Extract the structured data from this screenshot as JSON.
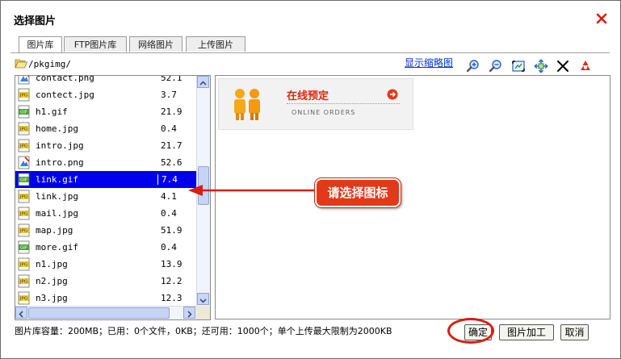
{
  "dialog": {
    "title": "选择图片"
  },
  "tabs": [
    {
      "label": "图片库",
      "active": true
    },
    {
      "label": "FTP图片库",
      "active": false
    },
    {
      "label": "网络图片",
      "active": false
    },
    {
      "label": "上传图片",
      "active": false
    }
  ],
  "toolbar": {
    "path": "/pkgimg/",
    "thumbnail_link": "显示缩略图",
    "icons": [
      "zoom-in-icon",
      "zoom-out-icon",
      "fit-icon",
      "original-size-icon",
      "delete-icon",
      "refresh-icon"
    ]
  },
  "files": [
    {
      "name": "contact.png",
      "size": "52.1",
      "type": "png"
    },
    {
      "name": "contect.jpg",
      "size": "3.7",
      "type": "jpg"
    },
    {
      "name": "h1.gif",
      "size": "21.9",
      "type": "gif"
    },
    {
      "name": "home.jpg",
      "size": "0.4",
      "type": "jpg"
    },
    {
      "name": "intro.jpg",
      "size": "21.7",
      "type": "jpg"
    },
    {
      "name": "intro.png",
      "size": "52.6",
      "type": "png"
    },
    {
      "name": "link.gif",
      "size": "7.4",
      "type": "gif",
      "selected": true
    },
    {
      "name": "link.jpg",
      "size": "4.1",
      "type": "jpg"
    },
    {
      "name": "mail.jpg",
      "size": "0.4",
      "type": "jpg"
    },
    {
      "name": "map.jpg",
      "size": "51.9",
      "type": "jpg"
    },
    {
      "name": "more.gif",
      "size": "0.4",
      "type": "gif"
    },
    {
      "name": "n1.jpg",
      "size": "13.9",
      "type": "jpg"
    },
    {
      "name": "n2.jpg",
      "size": "12.2",
      "type": "jpg"
    },
    {
      "name": "n3.jpg",
      "size": "12.3",
      "type": "jpg"
    }
  ],
  "preview": {
    "title": "在线预定",
    "subtitle": "ONLINE ORDERS"
  },
  "callout": {
    "text": "请选择图标"
  },
  "status": "图片库容量：200MB；已用：0个文件，0KB；还可用：1000个；单个上传最大限制为2000KB",
  "buttons": {
    "ok": "确定",
    "edit": "图片加工",
    "cancel": "取消"
  },
  "colors": {
    "selected_row": "#0000ee",
    "callout": "#e2391b",
    "link": "#0033cc",
    "close": "#d81e10"
  }
}
